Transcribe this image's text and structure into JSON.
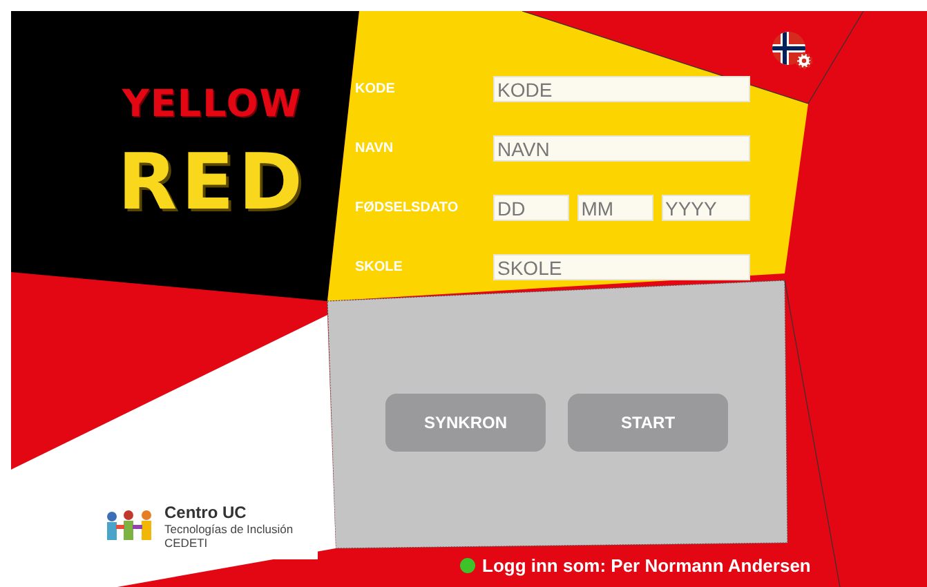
{
  "logo": {
    "line_1": "YELLOW",
    "line_2": "RED"
  },
  "form": {
    "fields": [
      {
        "label": "KODE",
        "inputs": [
          {
            "placeholder": "KODE"
          }
        ]
      },
      {
        "label": "NAVN",
        "inputs": [
          {
            "placeholder": "NAVN"
          }
        ]
      },
      {
        "label": "FØDSELSDATO",
        "inputs": [
          {
            "placeholder": "DD"
          },
          {
            "placeholder": "MM"
          },
          {
            "placeholder": "YYYY"
          }
        ]
      },
      {
        "label": "SKOLE",
        "inputs": [
          {
            "placeholder": "SKOLE"
          }
        ]
      }
    ]
  },
  "buttons": [
    "SYNKRON",
    "START"
  ],
  "partner": {
    "name": "Centro UC",
    "subtitle": "Tecnologías de Inclusión",
    "acronym": "CEDETI"
  },
  "status": {
    "text": "Logg inn som: Per Normann Andersen",
    "online": true
  }
}
